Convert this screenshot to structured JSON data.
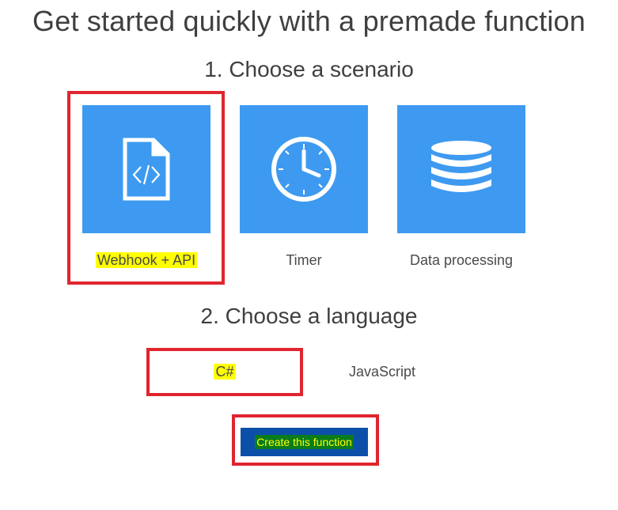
{
  "header": {
    "title": "Get started quickly with a premade function"
  },
  "step1": {
    "title": "1. Choose a scenario",
    "scenarios": [
      {
        "label": "Webhook + API",
        "icon": "code-file-icon",
        "selected": true
      },
      {
        "label": "Timer",
        "icon": "clock-icon",
        "selected": false
      },
      {
        "label": "Data processing",
        "icon": "database-icon",
        "selected": false
      }
    ]
  },
  "step2": {
    "title": "2. Choose a language",
    "languages": [
      {
        "label": "C#",
        "selected": true
      },
      {
        "label": "JavaScript",
        "selected": false
      }
    ]
  },
  "actions": {
    "create_label": "Create this function"
  },
  "colors": {
    "tile": "#3e9af0",
    "highlight_box": "#e0252f",
    "highlight_text": "#ffff00",
    "button": "#0c4fa8"
  }
}
